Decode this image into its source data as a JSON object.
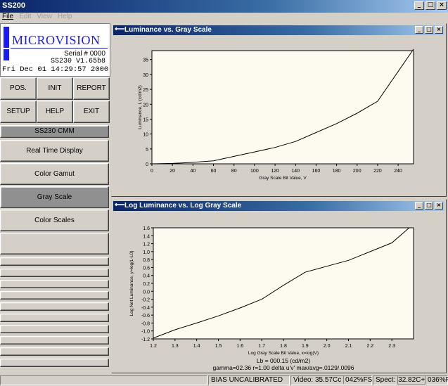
{
  "app": {
    "title": "SS200"
  },
  "menu": [
    {
      "label": "File",
      "disabled": false
    },
    {
      "label": "Edit",
      "disabled": true
    },
    {
      "label": "View",
      "disabled": true
    },
    {
      "label": "Help",
      "disabled": true
    }
  ],
  "logo": {
    "brand": "MICROVISION",
    "serial": "Serial # 0000",
    "version": "SS230 V1.65b8",
    "datetime": "Fri Dec 01 14:29:57 2000"
  },
  "buttons": {
    "pos": "POS.",
    "init": "INIT",
    "report": "REPORT",
    "setup": "SETUP",
    "help": "HELP",
    "exit": "EXIT"
  },
  "comm_label": "SS230 CMM",
  "modes": {
    "realtime": "Real Time Display",
    "gamut": "Color Gamut",
    "grayscale": "Gray Scale",
    "colorscales": "Color Scales"
  },
  "window1": {
    "title": "Luminance vs. Gray Scale"
  },
  "window2": {
    "title": "Log Luminance vs. Log Gray Scale"
  },
  "chart_data": [
    {
      "type": "line",
      "title": "",
      "xlabel": "Gray Scale Bit Value, V",
      "ylabel": "Luminance, L (cd/m2)",
      "xlim": [
        0,
        255
      ],
      "ylim": [
        0,
        38
      ],
      "xticks": [
        0,
        20,
        40,
        60,
        80,
        100,
        120,
        140,
        160,
        180,
        200,
        220,
        240
      ],
      "yticks": [
        0,
        5,
        10,
        15,
        20,
        25,
        30,
        35
      ],
      "x": [
        0,
        20,
        40,
        60,
        80,
        100,
        120,
        140,
        160,
        180,
        200,
        220,
        240,
        255
      ],
      "y": [
        0,
        0.15,
        0.5,
        1.0,
        2.5,
        4.0,
        5.5,
        7.5,
        10.5,
        13.5,
        17.0,
        21.0,
        31.0,
        38.5
      ]
    },
    {
      "type": "line",
      "title": "",
      "xlabel": "Log Gray Scale Bit Value, x=log(V)",
      "ylabel": "Log Net Luminance, y=log(L-L0)",
      "xlim": [
        1.2,
        2.4
      ],
      "ylim": [
        -1.2,
        1.6
      ],
      "xticks": [
        1.2,
        1.3,
        1.4,
        1.5,
        1.6,
        1.7,
        1.8,
        1.9,
        2.0,
        2.1,
        2.2,
        2.3
      ],
      "yticks": [
        -1.2,
        -1.0,
        -0.8,
        -0.6,
        -0.4,
        -0.2,
        0.0,
        0.2,
        0.4,
        0.6,
        0.8,
        1.0,
        1.2,
        1.4,
        1.6
      ],
      "x": [
        1.2,
        1.3,
        1.4,
        1.5,
        1.6,
        1.7,
        1.8,
        1.9,
        2.0,
        2.1,
        2.2,
        2.3,
        2.38
      ],
      "y": [
        -1.18,
        -0.97,
        -0.8,
        -0.62,
        -0.42,
        -0.2,
        0.15,
        0.48,
        0.63,
        0.78,
        1.0,
        1.22,
        1.6
      ],
      "annotations": [
        "Lb = 000.15 (cd/m2)",
        "gamma=02.36 r=1.00  delta u'v' max/avg=.0129/.0096"
      ]
    }
  ],
  "status": {
    "bias": "BIAS UNCALIBRATED",
    "video_label": "Video:",
    "video_value": "35.57Cc",
    "video_fs": "042%FS",
    "spect_label": "Spect:",
    "spect_value": "32.82C+",
    "spect_fs": "036%FS"
  }
}
